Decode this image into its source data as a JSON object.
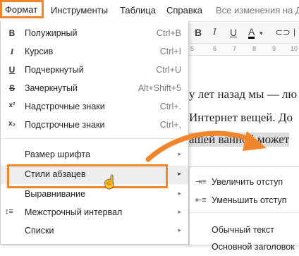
{
  "menubar": {
    "format": "Формат",
    "tools": "Инструменты",
    "table": "Таблица",
    "help": "Справка",
    "status": "Все изменения на Д"
  },
  "toolbar": {
    "bold": "B",
    "italic": "I",
    "underline": "U",
    "textcolor": "A"
  },
  "ruler": [
    "5",
    "6",
    "7",
    "8",
    "9",
    "10"
  ],
  "document": {
    "line1": "у лет назад мы — лю",
    "line2": "Интернет вещей. До",
    "line3": "ашей ванной может"
  },
  "format_menu": {
    "items": [
      {
        "icon": "B",
        "label": "Полужирный",
        "shortcut": "Ctrl+B"
      },
      {
        "icon": "I",
        "label": "Курсив",
        "shortcut": "Ctrl+I"
      },
      {
        "icon": "U",
        "label": "Подчеркнутый",
        "shortcut": "Ctrl+U"
      },
      {
        "icon": "S",
        "label": "Зачеркнутый",
        "shortcut": "Alt+Shift+5"
      },
      {
        "icon": "x²",
        "label": "Надстрочные знаки",
        "shortcut": "Ctrl+."
      },
      {
        "icon": "x₂",
        "label": "Подстрочные знаки",
        "shortcut": "Ctrl+,"
      },
      {
        "label": "Размер шрифта"
      },
      {
        "label": "Стили абзацев"
      },
      {
        "label": "Выравнивание"
      },
      {
        "icon": "↕≡",
        "label": "Межстрочный интервал"
      },
      {
        "label": "Списки"
      }
    ],
    "submenu_arrow": "▸"
  },
  "paragraph_styles_submenu": {
    "items": [
      {
        "label": "Увеличить отступ"
      },
      {
        "label": "Уменьшить отступ"
      },
      {
        "label": "Обычный текст"
      },
      {
        "label": "Основной заголовок"
      }
    ]
  },
  "colors": {
    "highlight_box": "#f0852b",
    "arrow": "#f0852b"
  }
}
